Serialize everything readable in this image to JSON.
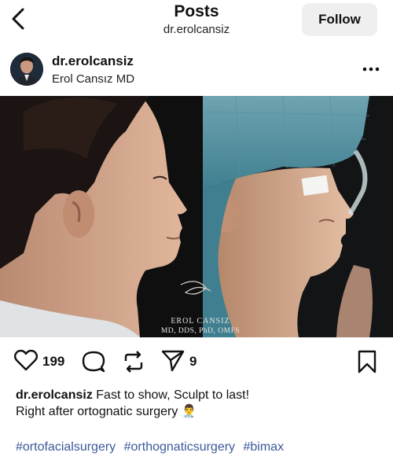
{
  "header": {
    "title": "Posts",
    "subtitle": "dr.erolcansiz",
    "follow_label": "Follow"
  },
  "post": {
    "username": "dr.erolcansiz",
    "display_name": "Erol Cansız MD",
    "image_credit_name": "EROL CANSIZ",
    "image_credit_degrees": "MD, DDS, PhD, OMFS",
    "likes": "199",
    "shares": "9",
    "caption_line1": "Fast to show, Sculpt to last!",
    "caption_line2": "Right after ortognatic surgery",
    "caption_emoji": "👨‍⚕️",
    "hashtags": [
      "#ortofacialsurgery",
      "#orthognaticsurgery",
      "#bimax"
    ]
  },
  "icons": {
    "back": "chevron-left-icon",
    "more": "more-horizontal-icon",
    "like": "heart-icon",
    "comment": "comment-bubble-icon",
    "repost": "repost-icon",
    "share": "paper-plane-icon",
    "save": "bookmark-icon"
  },
  "colors": {
    "hashtag": "#3b5998",
    "follow_button_bg": "#efefef"
  }
}
